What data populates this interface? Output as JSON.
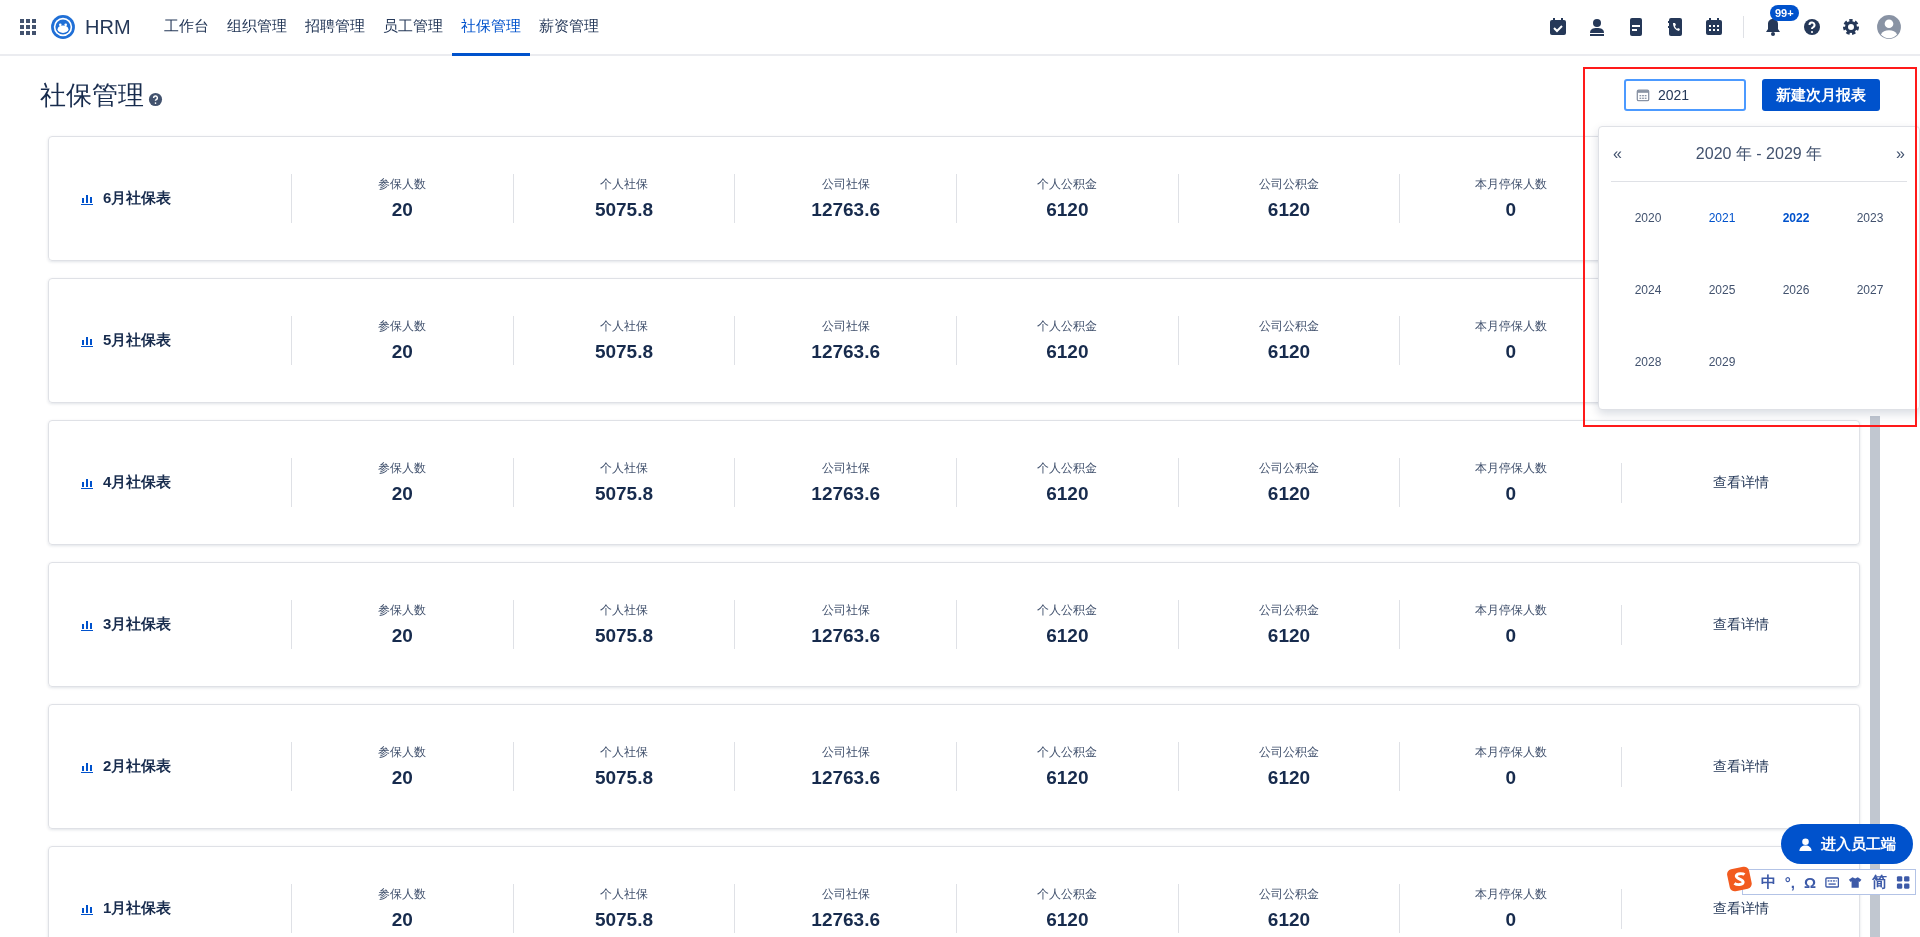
{
  "nav": {
    "brand": "HRM",
    "items": [
      {
        "label": "工作台",
        "selected": false
      },
      {
        "label": "组织管理",
        "selected": false
      },
      {
        "label": "招聘管理",
        "selected": false
      },
      {
        "label": "员工管理",
        "selected": false
      },
      {
        "label": "社保管理",
        "selected": true
      },
      {
        "label": "薪资管理",
        "selected": false
      }
    ]
  },
  "notifications": {
    "badge": "99+"
  },
  "page_title": "社保管理",
  "year_field": {
    "value": "2021"
  },
  "new_report_button": "新建次月报表",
  "year_popup": {
    "range": "2020 年 - 2029 年",
    "prev": "«",
    "next": "»",
    "years": [
      {
        "label": "2020",
        "selected": false,
        "current": false
      },
      {
        "label": "2021",
        "selected": true,
        "current": false
      },
      {
        "label": "2022",
        "selected": false,
        "current": true
      },
      {
        "label": "2023",
        "selected": false,
        "current": false
      },
      {
        "label": "2024",
        "selected": false,
        "current": false
      },
      {
        "label": "2025",
        "selected": false,
        "current": false
      },
      {
        "label": "2026",
        "selected": false,
        "current": false
      },
      {
        "label": "2027",
        "selected": false,
        "current": false
      },
      {
        "label": "2028",
        "selected": false,
        "current": false
      },
      {
        "label": "2029",
        "selected": false,
        "current": false
      }
    ]
  },
  "reports": [
    {
      "title": "6月社保表",
      "metrics": [
        {
          "label": "参保人数",
          "value": "20"
        },
        {
          "label": "个人社保",
          "value": "5075.8"
        },
        {
          "label": "公司社保",
          "value": "12763.6"
        },
        {
          "label": "个人公积金",
          "value": "6120"
        },
        {
          "label": "公司公积金",
          "value": "6120"
        },
        {
          "label": "本月停保人数",
          "value": "0"
        }
      ]
    },
    {
      "title": "5月社保表",
      "metrics": [
        {
          "label": "参保人数",
          "value": "20"
        },
        {
          "label": "个人社保",
          "value": "5075.8"
        },
        {
          "label": "公司社保",
          "value": "12763.6"
        },
        {
          "label": "个人公积金",
          "value": "6120"
        },
        {
          "label": "公司公积金",
          "value": "6120"
        },
        {
          "label": "本月停保人数",
          "value": "0"
        }
      ]
    },
    {
      "title": "4月社保表",
      "metrics": [
        {
          "label": "参保人数",
          "value": "20"
        },
        {
          "label": "个人社保",
          "value": "5075.8"
        },
        {
          "label": "公司社保",
          "value": "12763.6"
        },
        {
          "label": "个人公积金",
          "value": "6120"
        },
        {
          "label": "公司公积金",
          "value": "6120"
        },
        {
          "label": "本月停保人数",
          "value": "0"
        }
      ],
      "details": "查看详情"
    },
    {
      "title": "3月社保表",
      "metrics": [
        {
          "label": "参保人数",
          "value": "20"
        },
        {
          "label": "个人社保",
          "value": "5075.8"
        },
        {
          "label": "公司社保",
          "value": "12763.6"
        },
        {
          "label": "个人公积金",
          "value": "6120"
        },
        {
          "label": "公司公积金",
          "value": "6120"
        },
        {
          "label": "本月停保人数",
          "value": "0"
        }
      ],
      "details": "查看详情"
    },
    {
      "title": "2月社保表",
      "metrics": [
        {
          "label": "参保人数",
          "value": "20"
        },
        {
          "label": "个人社保",
          "value": "5075.8"
        },
        {
          "label": "公司社保",
          "value": "12763.6"
        },
        {
          "label": "个人公积金",
          "value": "6120"
        },
        {
          "label": "公司公积金",
          "value": "6120"
        },
        {
          "label": "本月停保人数",
          "value": "0"
        }
      ],
      "details": "查看详情"
    },
    {
      "title": "1月社保表",
      "metrics": [
        {
          "label": "参保人数",
          "value": "20"
        },
        {
          "label": "个人社保",
          "value": "5075.8"
        },
        {
          "label": "公司社保",
          "value": "12763.6"
        },
        {
          "label": "个人公积金",
          "value": "6120"
        },
        {
          "label": "公司公积金",
          "value": "6120"
        },
        {
          "label": "本月停保人数",
          "value": "0"
        }
      ],
      "details": "查看详情"
    }
  ],
  "employee_portal_button": "进入员工端",
  "ime_bar": {
    "texts": [
      "中",
      "°,",
      "Ω",
      "简"
    ]
  }
}
